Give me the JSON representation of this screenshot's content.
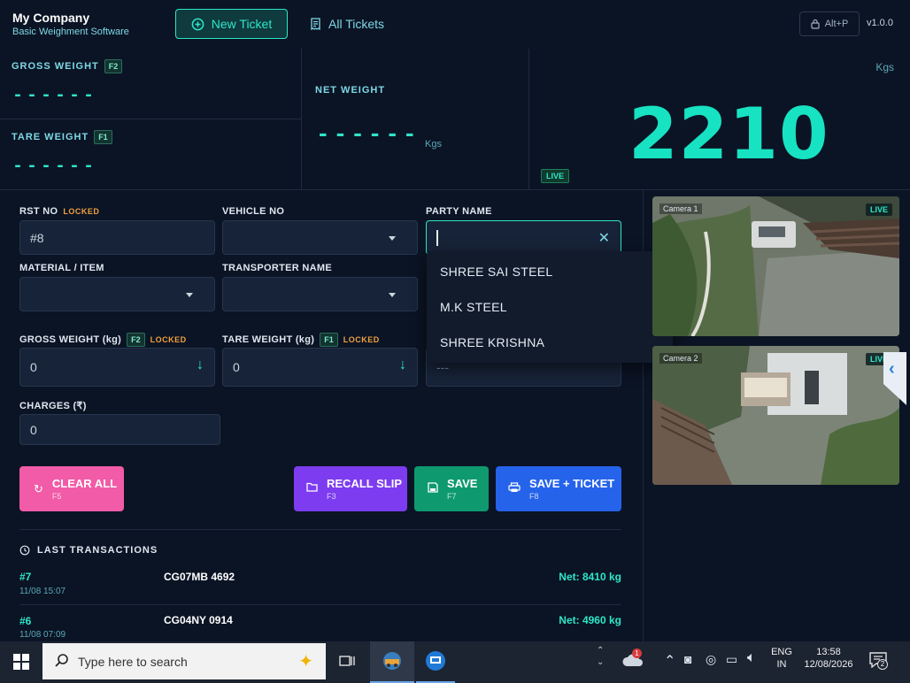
{
  "header": {
    "company": "My Company",
    "subtitle": "Basic Weighment Software",
    "new_ticket": "New Ticket",
    "all_tickets": "All Tickets",
    "shortcut": "Alt+P",
    "version": "v1.0.0"
  },
  "weights": {
    "gross_label": "GROSS WEIGHT",
    "gross_key": "F2",
    "gross_value": "------",
    "tare_label": "TARE WEIGHT",
    "tare_key": "F1",
    "tare_value": "------",
    "net_label": "NET WEIGHT",
    "net_value": "------",
    "net_unit": "Kgs",
    "live_value": "2210",
    "live_unit": "Kgs",
    "live_badge": "LIVE"
  },
  "form": {
    "rst_label": "RST NO",
    "rst_locked": "LOCKED",
    "rst_value": "#8",
    "vehicle_label": "VEHICLE NO",
    "party_label": "PARTY NAME",
    "material_label": "MATERIAL / ITEM",
    "transporter_label": "TRANSPORTER NAME",
    "gross_label": "GROSS WEIGHT (kg)",
    "gross_key": "F2",
    "gross_locked": "LOCKED",
    "gross_value": "0",
    "tare_label": "TARE WEIGHT (kg)",
    "tare_key": "F1",
    "tare_locked": "LOCKED",
    "tare_value": "0",
    "net_value": "---",
    "charges_label": "CHARGES (₹)",
    "charges_value": "0"
  },
  "party_options": [
    "SHREE SAI STEEL",
    "M.K STEEL",
    "SHREE KRISHNA"
  ],
  "actions": {
    "clear_label": "CLEAR ALL",
    "clear_key": "F5",
    "recall_label": "RECALL SLIP",
    "recall_key": "F3",
    "save_label": "SAVE",
    "save_key": "F7",
    "save_ticket_label": "SAVE + TICKET",
    "save_ticket_key": "F8",
    "colors": {
      "clear": "#f25ba7",
      "recall": "#7d3cf0",
      "save": "#0e9a6e",
      "save_ticket": "#2563eb"
    }
  },
  "transactions": {
    "title": "LAST TRANSACTIONS",
    "rows": [
      {
        "id": "#7",
        "date": "11/08 15:07",
        "vehicle": "CG07MB 4692",
        "net": "Net: 8410 kg"
      },
      {
        "id": "#6",
        "date": "11/08 07:09",
        "vehicle": "CG04NY 0914",
        "net": "Net: 4960 kg"
      }
    ]
  },
  "cameras": [
    {
      "label": "Camera 1",
      "live": "LIVE"
    },
    {
      "label": "Camera 2",
      "live": "LIVE"
    }
  ],
  "taskbar": {
    "search_placeholder": "Type here to search",
    "lang_top": "ENG",
    "lang_bottom": "IN",
    "time": "13:58",
    "date": "12/08/2026",
    "notif_count": "2",
    "weather_badge": "1"
  }
}
